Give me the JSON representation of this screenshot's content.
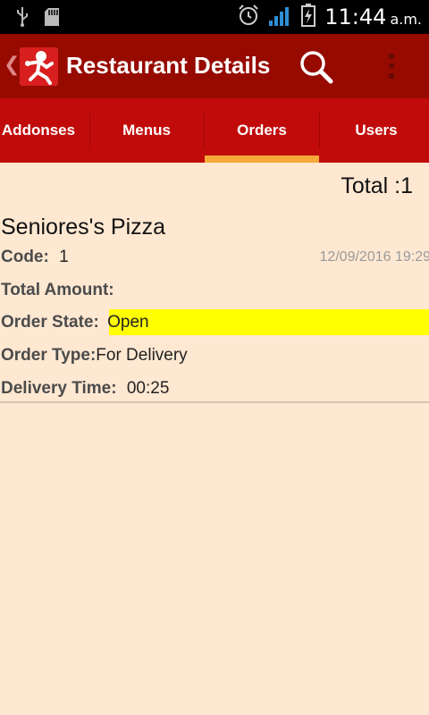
{
  "status_bar": {
    "time": "11:44",
    "ampm": "a.m.",
    "icons": [
      "usb-icon",
      "sd-card-icon",
      "alarm-icon",
      "signal-icon",
      "battery-charging-icon"
    ]
  },
  "action_bar": {
    "title": "Restaurant Details",
    "icons": [
      "back-icon",
      "app-logo",
      "search-icon",
      "overflow-menu-icon"
    ]
  },
  "tabs": [
    {
      "label": "Addonses",
      "selected": false
    },
    {
      "label": "Menus",
      "selected": false
    },
    {
      "label": "Orders",
      "selected": true
    },
    {
      "label": "Users",
      "selected": false
    }
  ],
  "summary": {
    "total": "Total :1"
  },
  "order": {
    "restaurant": "Seniores's Pizza",
    "code_label": "Code:",
    "code_value": "1",
    "date": "12/09/2016 19:29",
    "total_amount_label": "Total Amount:",
    "total_amount_value": "",
    "state_label": "Order State:",
    "state_value": "Open",
    "type_label": "Order Type:",
    "type_value": "For Delivery",
    "delivery_label": "Delivery Time:",
    "delivery_value": "00:25"
  },
  "colors": {
    "action_bar": "#970a00",
    "tab_bar": "#c10b0b",
    "tab_indicator": "#f4a938",
    "background": "#ffe8d2",
    "state_highlight": "#ffff00"
  }
}
